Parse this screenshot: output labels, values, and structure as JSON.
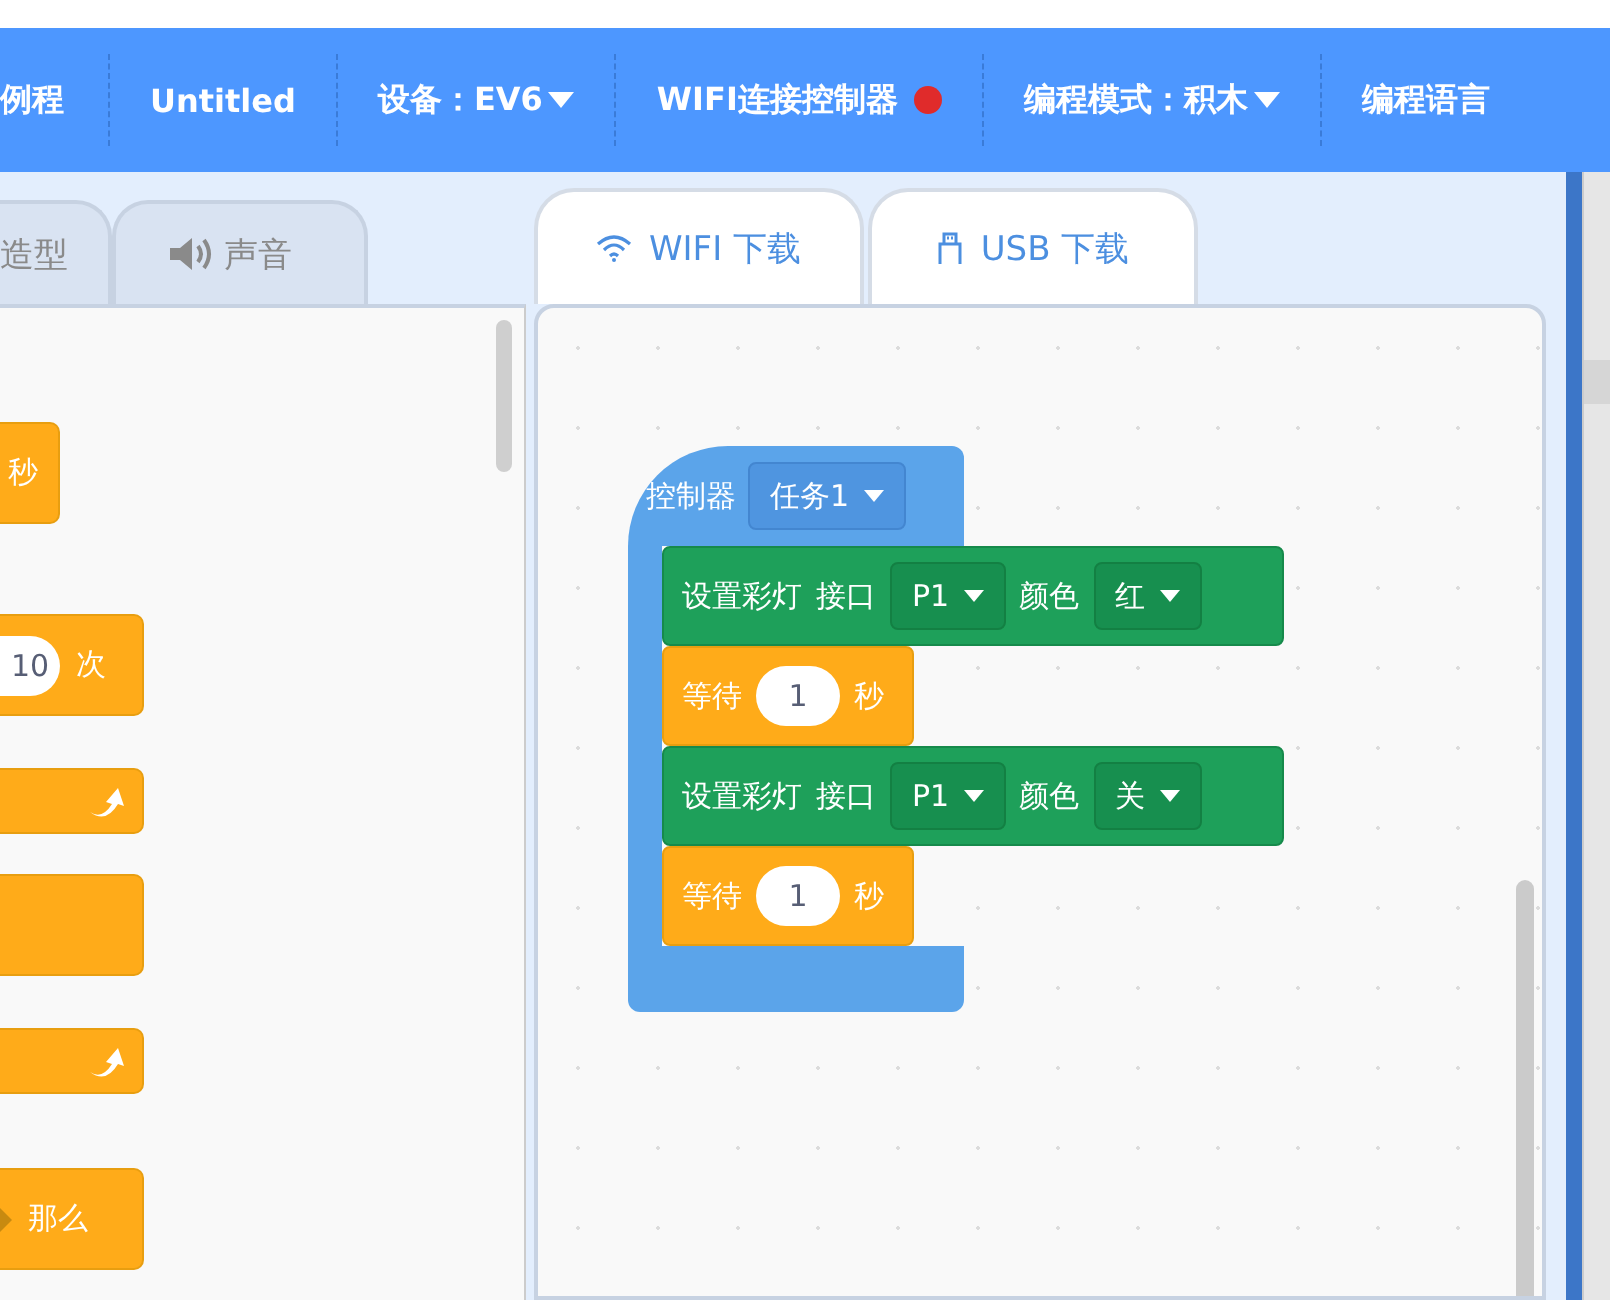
{
  "top_bar": {
    "items": [
      {
        "label": "例程",
        "kind": "text"
      },
      {
        "label": "Untitled",
        "kind": "text"
      },
      {
        "label": "设备：EV6",
        "kind": "dropdown"
      },
      {
        "label": "WIFI连接控制器",
        "kind": "status",
        "connected": false
      },
      {
        "label": "编程模式：积木",
        "kind": "dropdown"
      },
      {
        "label": "编程语言",
        "kind": "text"
      }
    ]
  },
  "palette_tabs": [
    {
      "label": "造型",
      "kind": "costume",
      "selected": false
    },
    {
      "label": "声音",
      "kind": "sound",
      "selected": false
    }
  ],
  "palette_blocks": [
    {
      "kind": "label",
      "text": "秒"
    },
    {
      "kind": "count",
      "value": "10",
      "text": "次"
    },
    {
      "kind": "arrow"
    },
    {
      "kind": "plain"
    },
    {
      "kind": "arrow"
    },
    {
      "kind": "condition",
      "text": "那么"
    }
  ],
  "download_tabs": [
    {
      "label": "WIFI 下载",
      "kind": "wifi"
    },
    {
      "label": "USB 下载",
      "kind": "usb"
    }
  ],
  "script": {
    "hat": {
      "label": "控制器",
      "dropdown": "任务1"
    },
    "blocks": [
      {
        "kind": "led",
        "label": "设置彩灯",
        "port_label": "接口",
        "port": "P1",
        "color_label": "颜色",
        "color_value": "红"
      },
      {
        "kind": "wait",
        "label": "等待",
        "value": "1",
        "unit": "秒"
      },
      {
        "kind": "led",
        "label": "设置彩灯",
        "port_label": "接口",
        "port": "P1",
        "color_label": "颜色",
        "color_value": "关"
      },
      {
        "kind": "wait",
        "label": "等待",
        "value": "1",
        "unit": "秒"
      }
    ]
  }
}
